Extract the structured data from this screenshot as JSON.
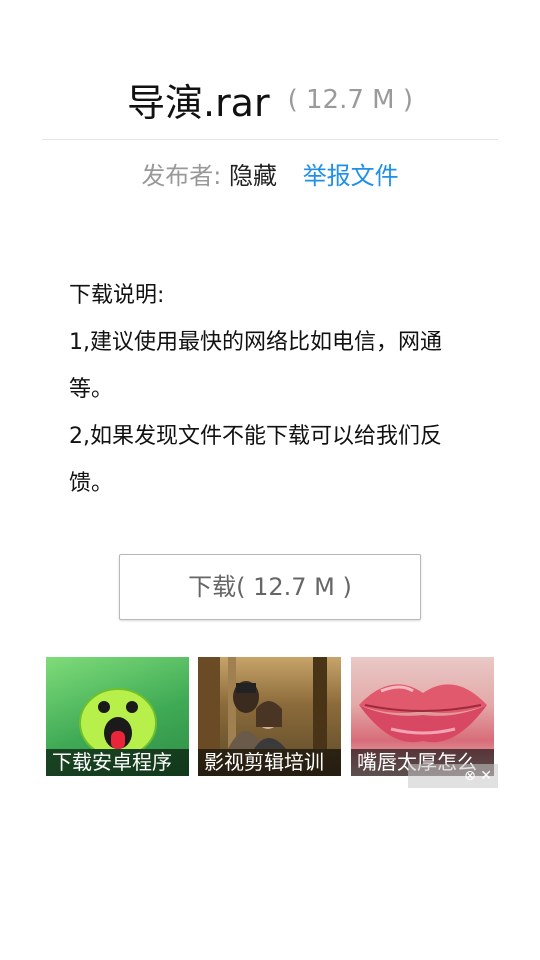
{
  "file": {
    "name": "导演.rar",
    "size": "( 12.7 M )"
  },
  "publisher": {
    "label": "发布者:",
    "value": "隐藏",
    "report_link": "举报文件"
  },
  "instructions": {
    "heading": "下载说明:",
    "line1": "1,建议使用最快的网络比如电信，网通等。",
    "line2": "2,如果发现文件不能下载可以给我们反馈。"
  },
  "download": {
    "label": "下载( 12.7 M )"
  },
  "ads": [
    {
      "caption": "下载安卓程序"
    },
    {
      "caption": "影视剪辑培训"
    },
    {
      "caption": "嘴唇太厚怎么"
    }
  ],
  "ad_close": {
    "label": "⊗ ✕"
  },
  "colors": {
    "link": "#1e90e8",
    "muted": "#999999"
  }
}
